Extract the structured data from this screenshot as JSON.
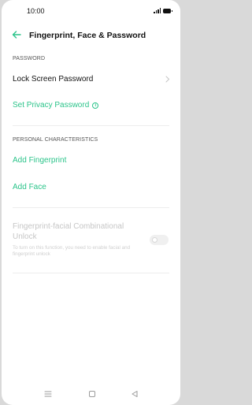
{
  "status_bar": {
    "time": "10:00"
  },
  "header": {
    "title": "Fingerprint, Face & Password"
  },
  "password_section": {
    "label": "PASSWORD",
    "lock_screen_password": "Lock Screen Password",
    "set_privacy_password": "Set Privacy Password"
  },
  "personal_section": {
    "label": "PERSONAL CHARACTERISTICS",
    "add_fingerprint": "Add Fingerprint",
    "add_face": "Add Face"
  },
  "combinational": {
    "title": "Fingerprint-facial Combinational Unlock",
    "subtitle": "To turn on this function, you need to enable facial and fingerprint unlock",
    "enabled": false
  },
  "colors": {
    "accent": "#2bc48a",
    "disabled_text": "#c6c6c6"
  },
  "icons": {
    "back": "arrow-left-icon",
    "chevron": "chevron-right-icon",
    "info": "info-icon",
    "nav_menu": "menu-icon",
    "nav_home": "home-icon",
    "nav_back": "triangle-back-icon"
  }
}
